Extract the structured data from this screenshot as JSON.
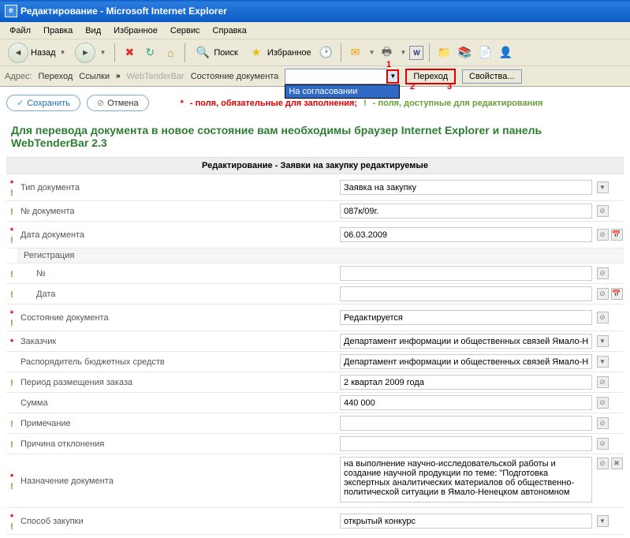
{
  "window": {
    "title": "Редактирование - Microsoft Internet Explorer"
  },
  "menu": [
    "Файл",
    "Правка",
    "Вид",
    "Избранное",
    "Сервис",
    "Справка"
  ],
  "toolbar": {
    "back": "Назад",
    "search": "Поиск",
    "favorites": "Избранное"
  },
  "addressbar": {
    "addr_label": "Адрес:",
    "perehod1": "Переход",
    "links": "Ссылки",
    "wtb": "WebTenderBar",
    "state_label": "Состояние документа",
    "state_value": "",
    "state_dd_item": "На согласовании",
    "perehod_btn": "Переход",
    "props_btn": "Свойства...",
    "annot1": "1",
    "annot2": "2",
    "annot3": "3"
  },
  "actions": {
    "save": "Сохранить",
    "cancel": "Отмена",
    "legend_req": "- поля, обязательные для заполнения;",
    "legend_edit": "- поля, доступные для редактирования"
  },
  "notice": "Для перевода документа в новое состояние вам необходимы браузер Internet Explorer и панель WebTenderBar 2.3",
  "section_title": "Редактирование - Заявки на закупку редактируемые",
  "fields": {
    "doc_type": {
      "mark": "*!",
      "label": "Тип документа",
      "value": "Заявка на закупку",
      "icons": [
        "dropdown"
      ]
    },
    "doc_num": {
      "mark": "!",
      "label": "№ документа",
      "value": "087к/09г.",
      "icons": [
        "lock"
      ]
    },
    "doc_date": {
      "mark": "*!",
      "label": "Дата документа",
      "value": "06.03.2009",
      "icons": [
        "lock",
        "cal"
      ]
    },
    "reg": {
      "mark": "",
      "label": "Регистрация",
      "value": "",
      "icons": []
    },
    "reg_num": {
      "mark": "!",
      "label": "№",
      "value": "",
      "icons": [
        "lock"
      ]
    },
    "reg_date": {
      "mark": "!",
      "label": "Дата",
      "value": "",
      "icons": [
        "lock",
        "cal"
      ]
    },
    "state": {
      "mark": "*!",
      "label": "Состояние документа",
      "value": "Редактируется",
      "icons": [
        "lock"
      ]
    },
    "customer": {
      "mark": "*",
      "label": "Заказчик",
      "value": "Департамент информации и общественных связей Ямало-Ненецкого авт",
      "icons": [
        "dropdown"
      ]
    },
    "manager": {
      "mark": "",
      "label": "Распорядитель бюджетных средств",
      "value": "Департамент информации и общественных связей Ямало-Ненецкого авт",
      "icons": [
        "dropdown"
      ]
    },
    "period": {
      "mark": "!",
      "label": "Период размещения заказа",
      "value": "2 квартал 2009 года",
      "icons": [
        "lock"
      ]
    },
    "sum": {
      "mark": "",
      "label": "Сумма",
      "value": "440 000",
      "icons": [
        "lock"
      ]
    },
    "note": {
      "mark": "!",
      "label": "Примечание",
      "value": "",
      "icons": [
        "lock"
      ]
    },
    "reject": {
      "mark": "!",
      "label": "Причина отклонения",
      "value": "",
      "icons": [
        "lock"
      ]
    },
    "purpose": {
      "mark": "*!",
      "label": "Назначение документа",
      "value": "на выполнение научно-исследовательской работы и создание научной продукции по теме: \"Подготовка экспертных аналитических материалов об общественно-политической ситуации в Ямало-Ненецком автономном",
      "icons": [
        "lock",
        "clear"
      ]
    },
    "method": {
      "mark": "*!",
      "label": "Способ закупки",
      "value": "открытый конкурс",
      "icons": [
        "dropdown"
      ]
    }
  }
}
